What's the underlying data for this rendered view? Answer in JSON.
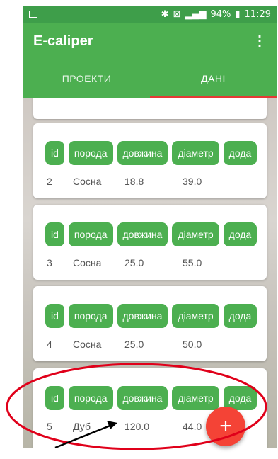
{
  "status": {
    "battery": "94%",
    "time": "11:29",
    "icons": [
      "bluetooth-icon",
      "mute-icon",
      "signal-icon",
      "battery-icon"
    ]
  },
  "app": {
    "title": "E-caliper",
    "menu_icon": "more-vert-icon"
  },
  "tabs": [
    {
      "label": "ПРОЕКТИ",
      "active": false
    },
    {
      "label": "ДАНІ",
      "active": true
    }
  ],
  "columns": [
    "id",
    "порода",
    "довжина",
    "діаметр",
    "дода"
  ],
  "rows": [
    {
      "id": "2",
      "species": "Сосна",
      "length": "18.8",
      "diameter": "39.0"
    },
    {
      "id": "3",
      "species": "Сосна",
      "length": "25.0",
      "diameter": "55.0"
    },
    {
      "id": "4",
      "species": "Сосна",
      "length": "25.0",
      "diameter": "50.0"
    },
    {
      "id": "5",
      "species": "Дуб",
      "length": "120.0",
      "diameter": "44.0"
    }
  ],
  "fab": {
    "label": "+",
    "icon": "add-icon"
  },
  "colors": {
    "primary": "#4caf50",
    "status_bar": "#3e9e4a",
    "accent": "#f44336",
    "annotation": "#e0001a"
  }
}
